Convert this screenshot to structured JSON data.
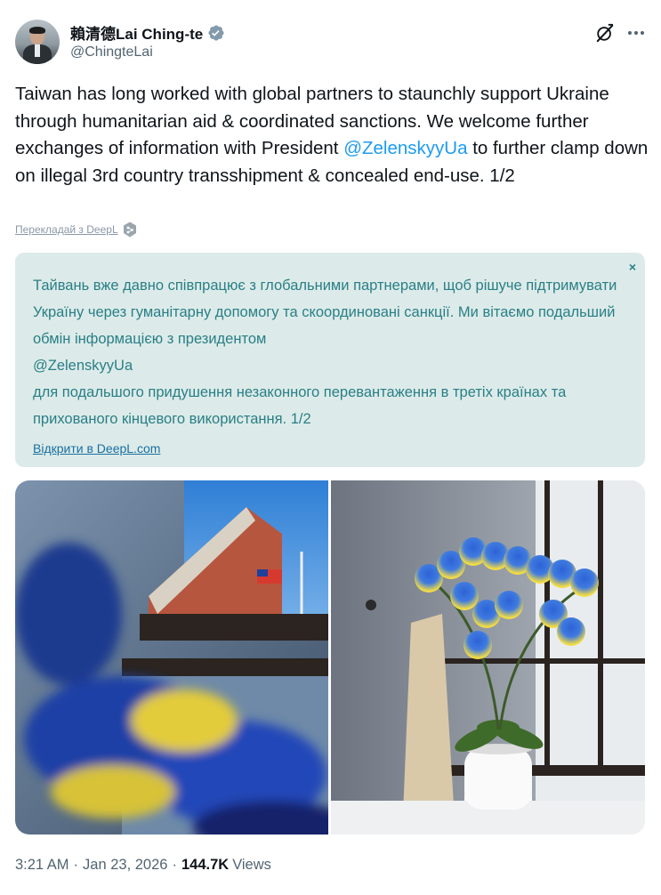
{
  "author": {
    "display_name": "賴清德Lai Ching-te",
    "handle": "@ChingteLai"
  },
  "icons": {
    "verified": "verified-badge-icon",
    "grok": "grok-icon",
    "more": "more-options-icon",
    "deepl": "deepl-icon",
    "close": "close-icon"
  },
  "tweet": {
    "text_before": "Taiwan has long worked with global partners to staunchly support Ukraine through humanitarian aid & coordinated sanctions. We welcome further exchanges of information with President ",
    "mention": "@ZelenskyyUa",
    "text_after": " to further clamp down on illegal 3rd country transshipment & concealed end-use. 1/2"
  },
  "translation": {
    "link_label": "Перекладай з DeepL",
    "close_glyph": "×",
    "text": "Тайвань вже давно співпрацює з глобальними партнерами, щоб рішуче підтримувати Україну через гуманітарну допомогу та скоординовані санкції. Ми вітаємо подальший обмін інформацією з президентом\n@ZelenskyyUa\n для подальшого придушення незаконного перевантаження в третіх країнах та прихованого кінцевого використання. 1/2",
    "open_label": "Відкрити в DeepL.com"
  },
  "meta": {
    "time": "3:21 AM",
    "date": "Jan 23, 2026",
    "views_count": "144.7K",
    "views_label": "Views",
    "separator": "·"
  },
  "colors": {
    "mention": "#1d9bf0",
    "verified": "#829aab",
    "translation_bg": "#dcebe9",
    "translation_text": "#2a7f86"
  }
}
